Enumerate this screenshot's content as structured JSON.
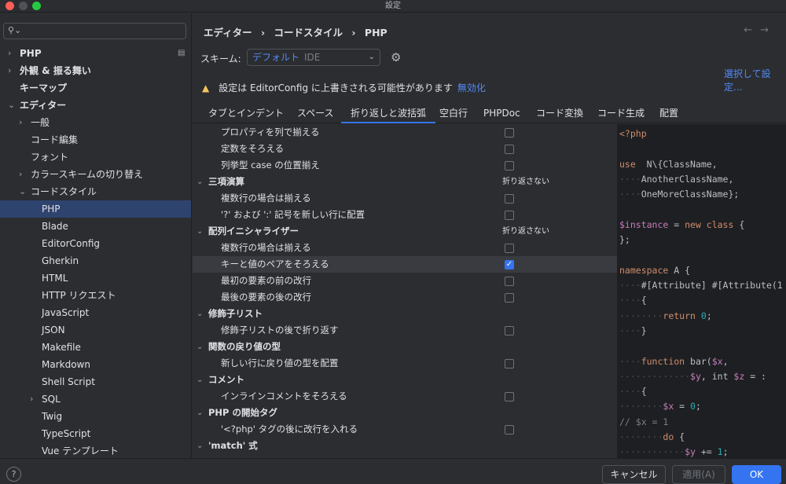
{
  "window": {
    "title": "設定"
  },
  "sidebar": {
    "search_placeholder": "",
    "items": [
      {
        "label": "PHP",
        "chevron": "›",
        "bold": true,
        "badge": "▤"
      },
      {
        "label": "外観 & 振る舞い",
        "chevron": "›",
        "bold": true
      },
      {
        "label": "キーマップ",
        "bold": true
      },
      {
        "label": "エディター",
        "chevron": "⌄",
        "bold": true
      },
      {
        "label": "一般",
        "chevron": "›"
      },
      {
        "label": "コード編集"
      },
      {
        "label": "フォント"
      },
      {
        "label": "カラースキームの切り替え",
        "chevron": "›"
      },
      {
        "label": "コードスタイル",
        "chevron": "⌄"
      },
      {
        "label": "PHP",
        "selected": true
      },
      {
        "label": "Blade"
      },
      {
        "label": "EditorConfig"
      },
      {
        "label": "Gherkin"
      },
      {
        "label": "HTML"
      },
      {
        "label": "HTTP リクエスト"
      },
      {
        "label": "JavaScript"
      },
      {
        "label": "JSON"
      },
      {
        "label": "Makefile"
      },
      {
        "label": "Markdown"
      },
      {
        "label": "Shell Script"
      },
      {
        "label": "SQL",
        "chevron": "›"
      },
      {
        "label": "Twig"
      },
      {
        "label": "TypeScript"
      },
      {
        "label": "Vue テンプレート"
      }
    ]
  },
  "breadcrumb": {
    "part1": "エディター",
    "sep": "›",
    "part2": "コードスタイル",
    "part3": "PHP"
  },
  "nav": {
    "back": "←",
    "forward": "→"
  },
  "scheme": {
    "label": "スキーム:",
    "value": "デフォルト",
    "tag": "IDE",
    "dropdown": "⌄"
  },
  "select_link": "選択して設定...",
  "warning": {
    "icon": "▲",
    "text": "設定は EditorConfig に上書きされる可能性があります",
    "link": "無効化"
  },
  "tabs": [
    "タブとインデント",
    "スペース",
    "折り返しと波括弧",
    "空白行",
    "PHPDoc",
    "コード変換",
    "コード生成",
    "配置"
  ],
  "active_tab": 2,
  "options": [
    {
      "label": "プロパティを列で揃える",
      "checked": false
    },
    {
      "label": "定数をそろえる",
      "checked": false
    },
    {
      "label": "列挙型 case の位置揃え",
      "checked": false
    },
    {
      "label": "三項演算",
      "group": true,
      "value": "折り返さない"
    },
    {
      "label": "複数行の場合は揃える",
      "checked": false
    },
    {
      "label": "'?' および ':' 記号を新しい行に配置",
      "checked": false
    },
    {
      "label": "配列イニシャライザー",
      "group": true,
      "value": "折り返さない"
    },
    {
      "label": "複数行の場合は揃える",
      "checked": false
    },
    {
      "label": "キーと値のペアをそろえる",
      "checked": true,
      "highlight": true
    },
    {
      "label": "最初の要素の前の改行",
      "checked": false
    },
    {
      "label": "最後の要素の後の改行",
      "checked": false
    },
    {
      "label": "修飾子リスト",
      "group": true
    },
    {
      "label": "修飾子リストの後で折り返す",
      "checked": false
    },
    {
      "label": "関数の戻り値の型",
      "group": true
    },
    {
      "label": "新しい行に戻り値の型を配置",
      "checked": false
    },
    {
      "label": "コメント",
      "group": true
    },
    {
      "label": "インラインコメントをそろえる",
      "checked": false
    },
    {
      "label": "PHP の開始タグ",
      "group": true
    },
    {
      "label": "'<?php' タグの後に改行を入れる",
      "checked": false
    },
    {
      "label": "'match' 式",
      "group": true
    }
  ],
  "code_lines": [
    [
      [
        "k",
        "<?php"
      ]
    ],
    [],
    [
      [
        "k",
        "use"
      ],
      [
        "",
        "  N\\{ClassName,"
      ]
    ],
    [
      [
        "d",
        "····"
      ],
      [
        "",
        "AnotherClassName,"
      ]
    ],
    [
      [
        "d",
        "····"
      ],
      [
        "",
        "OneMoreClassName};"
      ]
    ],
    [],
    [
      [
        "vr",
        "$instance"
      ],
      [
        "",
        " = "
      ],
      [
        "k",
        "new class"
      ],
      [
        "",
        " {"
      ]
    ],
    [
      [
        "",
        "};"
      ]
    ],
    [],
    [
      [
        "k",
        "namespace"
      ],
      [
        "",
        " A {"
      ]
    ],
    [
      [
        "d",
        "····"
      ],
      [
        "",
        "#[Attribute] #[Attribute(1"
      ]
    ],
    [
      [
        "d",
        "····"
      ],
      [
        "",
        "{"
      ]
    ],
    [
      [
        "d",
        "········"
      ],
      [
        "k",
        "return"
      ],
      [
        "",
        " "
      ],
      [
        "n",
        "0"
      ],
      [
        "",
        ";"
      ]
    ],
    [
      [
        "d",
        "····"
      ],
      [
        "",
        "}"
      ]
    ],
    [],
    [
      [
        "d",
        "····"
      ],
      [
        "k",
        "function"
      ],
      [
        "",
        " bar("
      ],
      [
        "vr",
        "$x"
      ],
      [
        "",
        ","
      ]
    ],
    [
      [
        "d",
        "·············"
      ],
      [
        "vr",
        "$y"
      ],
      [
        "",
        ", int "
      ],
      [
        "vr",
        "$z"
      ],
      [
        "",
        " = :"
      ]
    ],
    [
      [
        "d",
        "····"
      ],
      [
        "",
        "{"
      ]
    ],
    [
      [
        "d",
        "········"
      ],
      [
        "vr",
        "$x"
      ],
      [
        "",
        " = "
      ],
      [
        "n",
        "0"
      ],
      [
        "",
        ";"
      ]
    ],
    [
      [
        "c",
        "// $x = 1"
      ]
    ],
    [
      [
        "d",
        "········"
      ],
      [
        "k",
        "do"
      ],
      [
        "",
        " {"
      ]
    ],
    [
      [
        "d",
        "············"
      ],
      [
        "vr",
        "$y"
      ],
      [
        "",
        " += "
      ],
      [
        "n",
        "1"
      ],
      [
        "",
        ";"
      ]
    ]
  ],
  "footer": {
    "help": "?",
    "cancel": "キャンセル",
    "apply": "適用(A)",
    "ok": "OK"
  },
  "colors": {
    "accent": "#3574f0",
    "link": "#548af7",
    "warning": "#f2c55c",
    "selection": "#2e436e"
  }
}
